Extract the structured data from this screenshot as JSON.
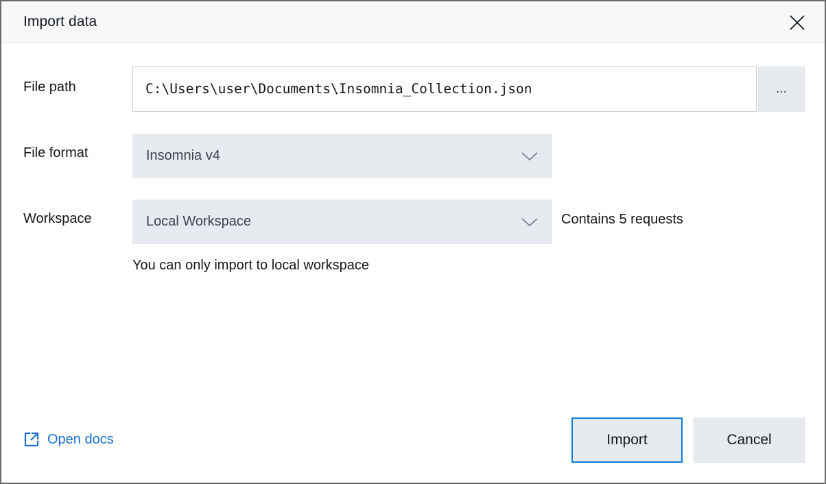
{
  "window": {
    "title": "Import data",
    "close_icon": "close-icon"
  },
  "form": {
    "file_path": {
      "label": "File path",
      "value": "C:\\Users\\user\\Documents\\Insomnia_Collection.json",
      "placeholder": "",
      "browse_label": "..."
    },
    "file_format": {
      "label": "File format",
      "value": "Insomnia v4",
      "chevron_icon": "chevron-down-icon"
    },
    "workspace": {
      "label": "Workspace",
      "value": "Local Workspace",
      "chevron_icon": "chevron-down-icon",
      "note": "Contains 5 requests",
      "helper": "You can only import to local workspace"
    }
  },
  "footer": {
    "open_docs": {
      "label": "Open docs",
      "icon": "external-link-icon"
    },
    "import_label": "Import",
    "cancel_label": "Cancel"
  },
  "colors": {
    "accent": "#0c7cd5",
    "link": "#1a6fd4",
    "control_bg": "#e7ebef",
    "titlebar_bg": "#f6f8fa",
    "window_border": "#6b6b6b"
  }
}
